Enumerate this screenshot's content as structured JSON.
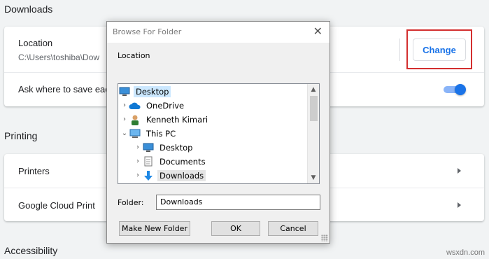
{
  "settings": {
    "downloads": {
      "title": "Downloads",
      "location_label": "Location",
      "location_path": "C:\\Users\\toshiba\\Dow",
      "change_button": "Change",
      "ask_label": "Ask where to save eac",
      "ask_enabled": true
    },
    "printing": {
      "title": "Printing",
      "printers": "Printers",
      "cloud_print": "Google Cloud Print"
    },
    "accessibility": {
      "title": "Accessibility"
    }
  },
  "dialog": {
    "title": "Browse For Folder",
    "close_glyph": "✕",
    "location_label": "Location",
    "tree": [
      {
        "label": "Desktop",
        "icon": "desktop-icon",
        "chevron": ""
      },
      {
        "label": "OneDrive",
        "icon": "cloud-icon",
        "chevron": "›"
      },
      {
        "label": "Kenneth Kimari",
        "icon": "user-icon",
        "chevron": "›"
      },
      {
        "label": "This PC",
        "icon": "computer-icon",
        "chevron": "⌄"
      },
      {
        "label": "Desktop",
        "icon": "desktop-icon",
        "chevron": "›"
      },
      {
        "label": "Documents",
        "icon": "document-icon",
        "chevron": "›"
      },
      {
        "label": "Downloads",
        "icon": "download-arrow-icon",
        "chevron": "›"
      }
    ],
    "folder_label": "Folder:",
    "folder_value": "Downloads",
    "buttons": {
      "new_folder": "Make New Folder",
      "ok": "OK",
      "cancel": "Cancel"
    }
  },
  "colors": {
    "accent": "#1a73e8",
    "highlight": "#d32f2f",
    "selection": "#cce8ff"
  },
  "watermark": "wsxdn.com"
}
